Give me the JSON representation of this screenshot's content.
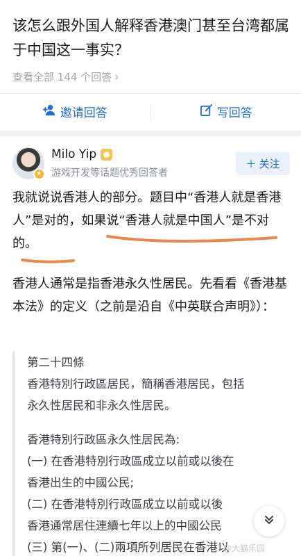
{
  "question": {
    "title": "该怎么跟外国人解释香港澳门甚至台湾都属于中国这一事实？",
    "meta": "查看全部 144 个回答",
    "meta_chevron": "›"
  },
  "actions": {
    "invite_label": "邀请回答",
    "write_label": "写回答",
    "invite_icon": "add-user-icon",
    "write_icon": "edit-icon",
    "accent_color": "#1f6fe0"
  },
  "answer": {
    "author_name": "Milo Yip",
    "author_desc": "游戏开发等话题优秀回答者",
    "follow_label": "关注",
    "paragraph1": "我就说说香港人的部分。题目中“香港人就是香港人”是对的，如果说“香港人就是中国人”是不对的。",
    "paragraph2": "香港人通常是指香港永久性居民。先看看《香港基本法》的定义（之前是沿自《中英联合声明》）：",
    "quote_lines": [
      "第二十四條",
      "香港特別行政區居民，簡稱香港居民，包括",
      "永久性居民和非永久性居民。",
      "",
      "香港特別行政區永久性居民為:",
      "(一) 在香港特別行政區成立以前或以後在",
      "香港出生的中國公民;",
      "(二) 在香港特別行政區成立以前或以後",
      "香港通常居住連續七年以上的中國公民",
      "(三) 第(一)、(二)兩項所列居民在香港以"
    ],
    "underline_color": "#e8894a"
  },
  "scroll_icon": "double-chevron-down-icon",
  "watermark": "@大猫乐园"
}
